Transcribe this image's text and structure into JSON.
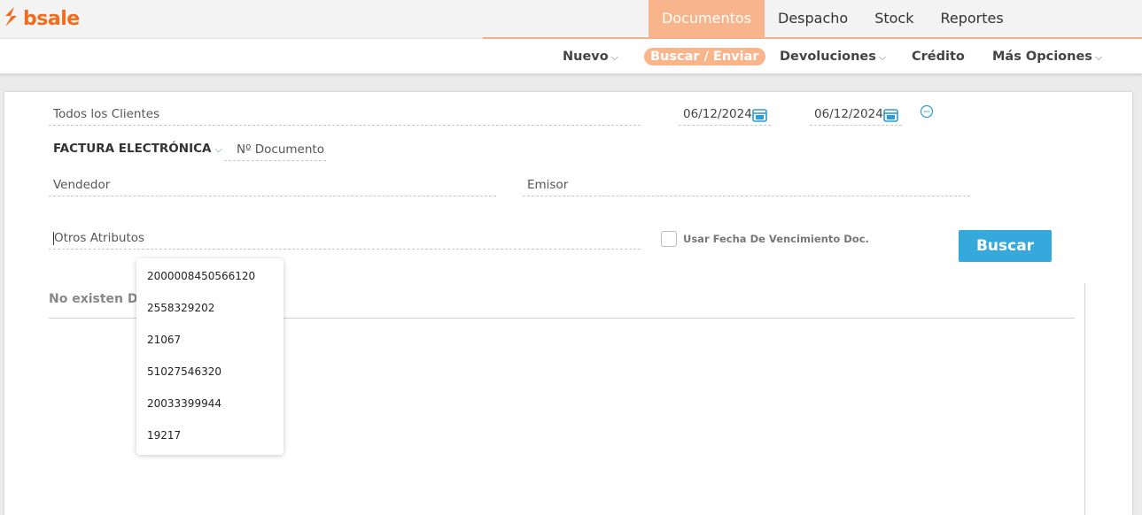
{
  "app": {
    "brand": "bsale",
    "colors": {
      "accent": "#f8b48b",
      "brand": "#f36b1c",
      "primary_button": "#35a8dc",
      "calendar_icon": "#2e9bd6"
    }
  },
  "main_nav": [
    "Documentos",
    "Despacho",
    "Stock",
    "Reportes"
  ],
  "main_nav_active": "Documentos",
  "sub_nav": {
    "nuevo": "Nuevo",
    "buscar_enviar": "Buscar / Enviar",
    "devoluciones": "Devoluciones",
    "credito": "Crédito",
    "mas_opciones": "Más Opciones",
    "chevron": "⌵"
  },
  "filters": {
    "clientes": "Todos los Clientes",
    "fecha_desde": "06/12/2024",
    "fecha_hasta": "06/12/2024",
    "tipo_documento": "FACTURA ELECTRÓNICA",
    "numero_documento_placeholder": "Nº Documento",
    "vendedor_placeholder": "Vendedor",
    "emisor_placeholder": "Emisor",
    "otros_atributos_placeholder": "Otros Atributos",
    "usar_fecha_vencimiento_label": "Usar Fecha De Vencimiento Doc.",
    "usar_fecha_vencimiento_checked": false,
    "buscar_label": "Buscar"
  },
  "results": {
    "empty_message": "No existen Doc"
  },
  "dropdown_options": [
    "2000008450566120",
    "2558329202",
    "21067",
    "51027546320",
    "20033399944",
    "19217"
  ],
  "icons": [
    "bsale-logo-icon",
    "calendar-icon",
    "clear-dates-icon",
    "chevron-down-icon"
  ]
}
